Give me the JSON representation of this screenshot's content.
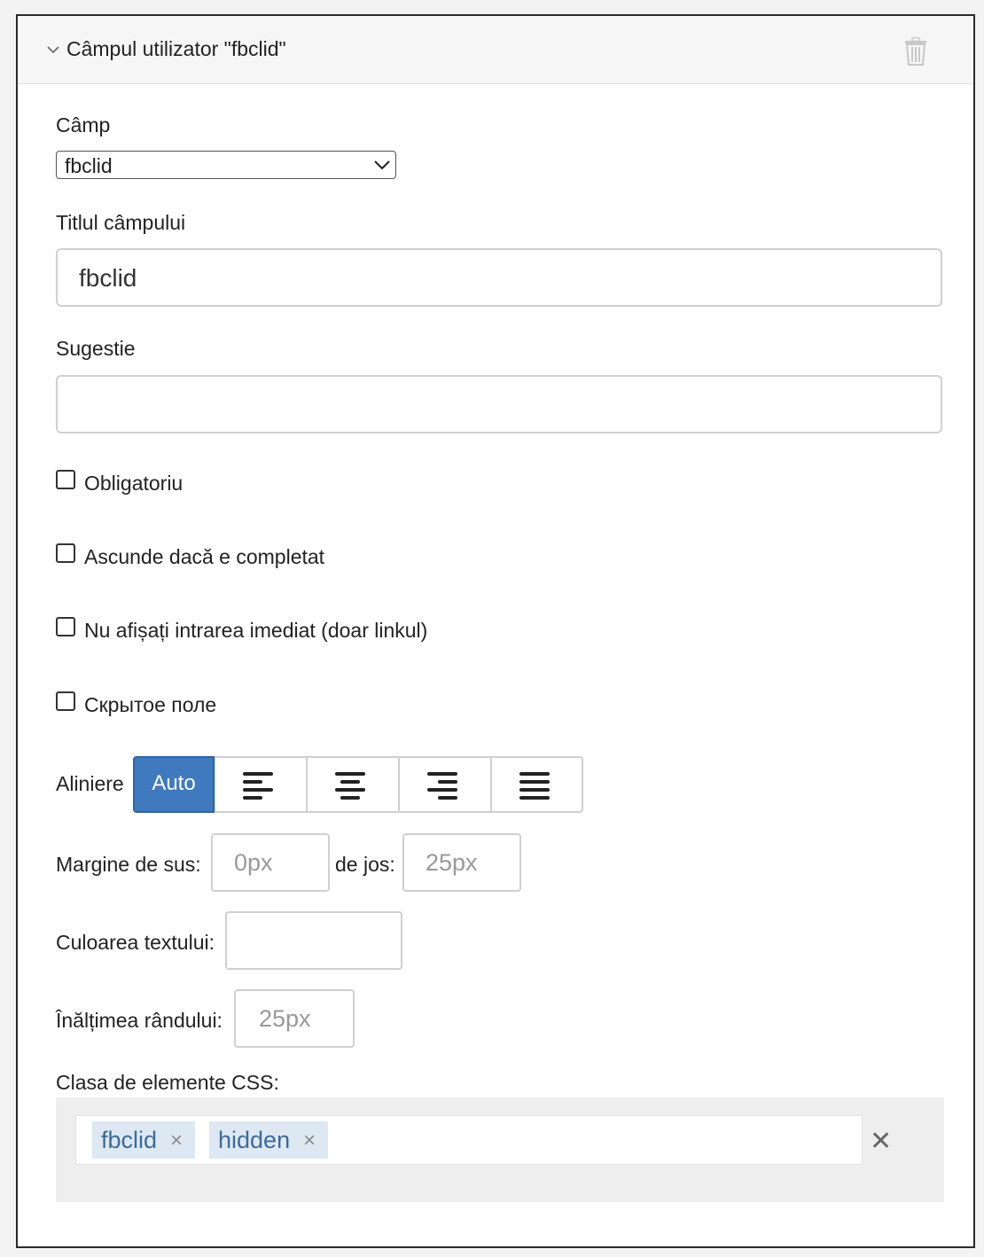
{
  "panel": {
    "title": "Câmpul utilizator \"fbclid\""
  },
  "field": {
    "label": "Câmp",
    "value": "fbclid"
  },
  "field_title": {
    "label": "Titlul câmpului",
    "value": "fbclid"
  },
  "hint": {
    "label": "Sugestie",
    "value": ""
  },
  "checkboxes": [
    {
      "label": "Obligatoriu",
      "checked": false
    },
    {
      "label": "Ascunde dacă e completat",
      "checked": false
    },
    {
      "label": "Nu afișați intrarea imediat (doar linkul)",
      "checked": false
    },
    {
      "label": "Скрытое поле",
      "checked": false
    }
  ],
  "alignment": {
    "label": "Aliniere",
    "options": [
      "Auto",
      "left",
      "center",
      "right",
      "justify"
    ],
    "selected": "Auto"
  },
  "margins": {
    "top_label": "Margine de sus:",
    "top_placeholder": "0px",
    "bottom_label": "de jos:",
    "bottom_placeholder": "25px"
  },
  "text_color": {
    "label": "Culoarea textului:",
    "value": ""
  },
  "line_height": {
    "label": "Înălțimea rândului:",
    "placeholder": "25px"
  },
  "css_class": {
    "label": "Clasa de elemente CSS:",
    "tags": [
      "fbclid",
      "hidden"
    ],
    "remove_symbol": "×",
    "clear_symbol": "✕"
  },
  "colors": {
    "accent": "#3f7abf",
    "tag_bg": "#dde8f3",
    "tag_text": "#3d6b96"
  }
}
